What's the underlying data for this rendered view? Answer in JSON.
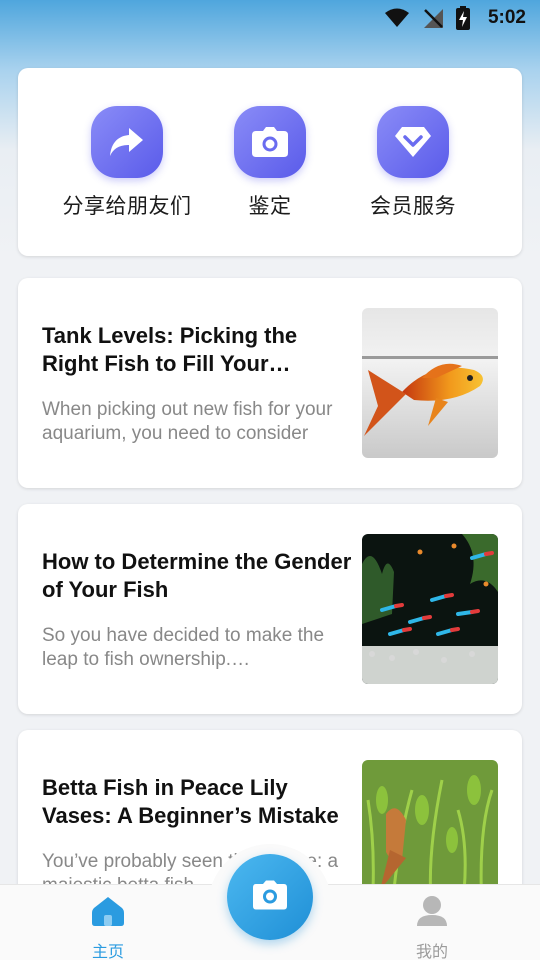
{
  "status_bar": {
    "time": "5:02",
    "icons": [
      "wifi-icon",
      "no-signal-icon",
      "battery-charging-icon"
    ]
  },
  "quick_actions": [
    {
      "label": "分享给朋友们",
      "icon": "share-icon"
    },
    {
      "label": "鉴定",
      "icon": "camera-icon"
    },
    {
      "label": "会员服务",
      "icon": "diamond-icon"
    }
  ],
  "articles": [
    {
      "title": "Tank Levels: Picking the Right Fish to Fill Your Aquarium",
      "summary": "When picking out new fish for your aquarium, you need to consider",
      "thumbnail": "orange-platy-fish-image"
    },
    {
      "title": "How to Determine the Gender of Your Fish",
      "summary": "So you have decided to make the leap to fish ownership. Congratulations",
      "thumbnail": "neon-tetra-tank-image"
    },
    {
      "title": "Betta Fish in Peace Lily Vases: A Beginner’s Mistake",
      "summary": "You’ve probably seen the picture: a majestic betta fish",
      "thumbnail": "betta-plant-tank-image"
    }
  ],
  "bottom_nav": {
    "home_label": "主页",
    "mine_label": "我的",
    "active_color": "#2a9be0",
    "inactive_color": "#9b9b9b"
  },
  "colors": {
    "quick_icon_accent": "#6a6cf0",
    "fab_accent": "#2a9be0"
  }
}
